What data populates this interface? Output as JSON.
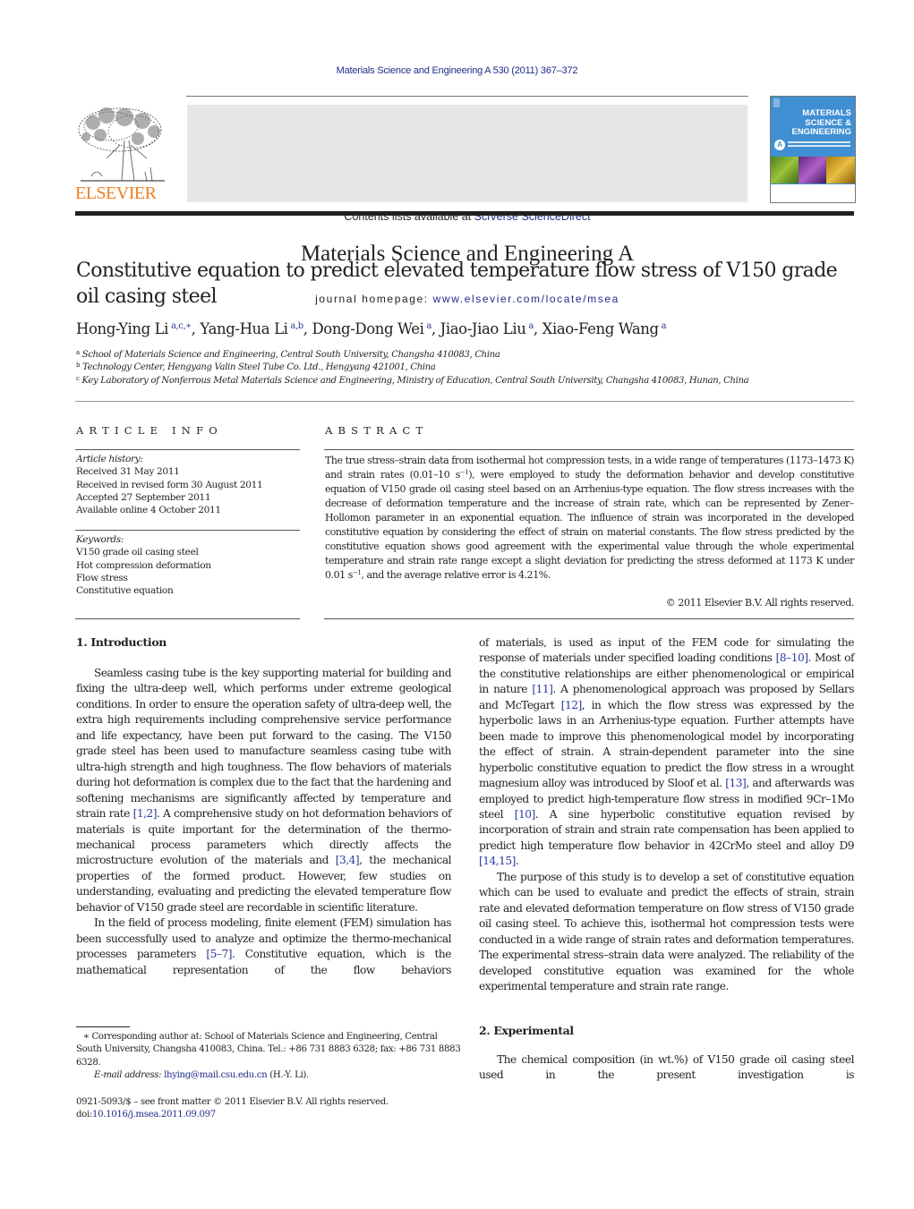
{
  "header": {
    "journal_ref": "Materials Science and Engineering A 530 (2011) 367–372",
    "contents_prefix": "Contents lists available at ",
    "contents_link": "SciVerse ScienceDirect",
    "journal_title": "Materials Science and Engineering A",
    "homepage_prefix": "journal homepage: ",
    "homepage_link": "www.elsevier.com/locate/msea",
    "publisher_logo_text": "ELSEVIER",
    "cover": {
      "title_lines": [
        "MATERIALS",
        "SCIENCE &",
        "ENGINEERING"
      ],
      "letter": "A",
      "bg_color": "#3f8fd2"
    }
  },
  "article": {
    "title": "Constitutive equation to predict elevated temperature flow stress of V150 grade oil casing steel",
    "authors": [
      {
        "name": "Hong-Ying Li",
        "sup": "a,c,∗",
        "sep": ", "
      },
      {
        "name": "Yang-Hua Li",
        "sup": "a,b",
        "sep": ", "
      },
      {
        "name": "Dong-Dong Wei",
        "sup": "a",
        "sep": ", "
      },
      {
        "name": "Jiao-Jiao Liu",
        "sup": "a",
        "sep": ", "
      },
      {
        "name": "Xiao-Feng Wang",
        "sup": "a",
        "sep": ""
      }
    ],
    "affiliations": [
      {
        "key": "a",
        "text": "School of Materials Science and Engineering, Central South University, Changsha 410083, China"
      },
      {
        "key": "b",
        "text": "Technology Center, Hengyang Valin Steel Tube Co. Ltd., Hengyang 421001, China"
      },
      {
        "key": "c",
        "text": "Key Laboratory of Nonferrous Metal Materials Science and Engineering, Ministry of Education, Central South University, Changsha 410083, Hunan, China"
      }
    ]
  },
  "article_info": {
    "label": "ARTICLE INFO",
    "history_heading": "Article history:",
    "history": [
      "Received 31 May 2011",
      "Received in revised form 30 August 2011",
      "Accepted 27 September 2011",
      "Available online 4 October 2011"
    ],
    "keywords_heading": "Keywords:",
    "keywords": [
      "V150 grade oil casing steel",
      "Hot compression deformation",
      "Flow stress",
      "Constitutive equation"
    ]
  },
  "abstract": {
    "label": "ABSTRACT",
    "part1": "The true stress–strain data from isothermal hot compression tests, in a wide range of temperatures (1173–1473 K) and strain rates (0.01–10 s",
    "sup1": "−1",
    "part2": "), were employed to study the deformation behavior and develop constitutive equation of V150 grade oil casing steel based on an Arrhenius-type equation. The flow stress increases with the decrease of deformation temperature and the increase of strain rate, which can be represented by Zener–Hollomon parameter in an exponential equation. The influence of strain was incorporated in the developed constitutive equation by considering the effect of strain on material constants. The flow stress predicted by the constitutive equation shows good agreement with the experimental value through the whole experimental temperature and strain rate range except a slight deviation for predicting the stress deformed at 1173 K under 0.01 s",
    "sup2": "−1",
    "part3": ", and the average relative error is 4.21%.",
    "copyright": "© 2011 Elsevier B.V. All rights reserved."
  },
  "sections": {
    "intro_heading": "1.  Introduction",
    "intro_p1": [
      {
        "t": "Seamless casing tube is the key supporting material for building and fixing the ultra-deep well, which performs under extreme geological conditions. In order to ensure the operation safety of ultra-deep well, the extra high requirements including comprehensive service performance and life expectancy, have been put forward to the casing. The V150 grade steel has been used to manufacture seamless casing tube with ultra-high strength and high toughness. The flow behaviors of materials during hot deformation is complex due to the fact that the hardening and softening mechanisms are significantly affected by temperature and strain rate "
      },
      {
        "c": "[1,2]"
      },
      {
        "t": ". A comprehensive study on hot deformation behaviors of materials is quite important for the determination of the thermo-mechanical process parameters which directly affects the microstructure evolution of the materials and "
      },
      {
        "c": "[3,4]"
      },
      {
        "t": ", the mechanical properties of the formed product. However, few studies on understanding, evaluating and predicting the elevated temperature flow behavior of V150 grade steel are recordable in scientific literature."
      }
    ],
    "intro_p2": [
      {
        "t": "In the field of process modeling, finite element (FEM) simulation has been successfully used to analyze and optimize the thermo-mechanical processes parameters "
      },
      {
        "c": "[5–7]"
      },
      {
        "t": ". Constitutive equation, which is the mathematical representation of the flow behaviors of materials, is used as input of the FEM code for simulating the response of materials under specified loading conditions "
      },
      {
        "c": "[8–10]"
      },
      {
        "t": ". Most of the constitutive relationships are either phenomenological or empirical in nature "
      },
      {
        "c": "[11]"
      },
      {
        "t": ". A phenomenological approach was proposed by Sellars and McTegart "
      },
      {
        "c": "[12]"
      },
      {
        "t": ", in which the flow stress was expressed by the hyperbolic laws in an Arrhenius-type equation. Further attempts have been made to improve this phenomenological model by incorporating the effect of strain. A strain-dependent parameter into the sine hyperbolic constitutive equation to predict the flow stress in a wrought magnesium alloy was introduced by Sloof et al. "
      },
      {
        "c": "[13]"
      },
      {
        "t": ", and afterwards was employed to predict high-temperature flow stress in modified 9Cr–1Mo steel "
      },
      {
        "c": "[10]"
      },
      {
        "t": ". A sine hyperbolic constitutive equation revised by incorporation of strain and strain rate compensation has been applied to predict high temperature flow behavior in 42CrMo steel and alloy D9 "
      },
      {
        "c": "[14,15]"
      },
      {
        "t": "."
      }
    ],
    "intro_p3": "The purpose of this study is to develop a set of constitutive equation which can be used to evaluate and predict the effects of strain, strain rate and elevated deformation temperature on flow stress of V150 grade oil casing steel. To achieve this, isothermal hot compression tests were conducted in a wide range of strain rates and deformation temperatures. The experimental stress–strain data were analyzed. The reliability of the developed constitutive equation was examined for the whole experimental temperature and strain rate range.",
    "exp_heading": "2.  Experimental",
    "exp_p1": "The chemical composition (in wt.%) of V150 grade oil casing steel used in the present investigation is"
  },
  "footnotes": {
    "corresponding": "∗  Corresponding author at: School of Materials Science and Engineering, Central South University, Changsha 410083, China. Tel.: +86 731 8883 6328; fax: +86 731 8883 6328.",
    "email_label": "E-mail address:",
    "email": "lhying@mail.csu.edu.cn",
    "email_suffix": " (H.-Y. Li).",
    "front_matter": "0921-5093/$ – see front matter © 2011 Elsevier B.V. All rights reserved.",
    "doi_prefix": "doi:",
    "doi": "10.1016/j.msea.2011.09.097"
  },
  "colors": {
    "link": "#1f2d8a",
    "elsevier_orange": "#f07f21",
    "banner_gray": "#e6e7e8"
  }
}
